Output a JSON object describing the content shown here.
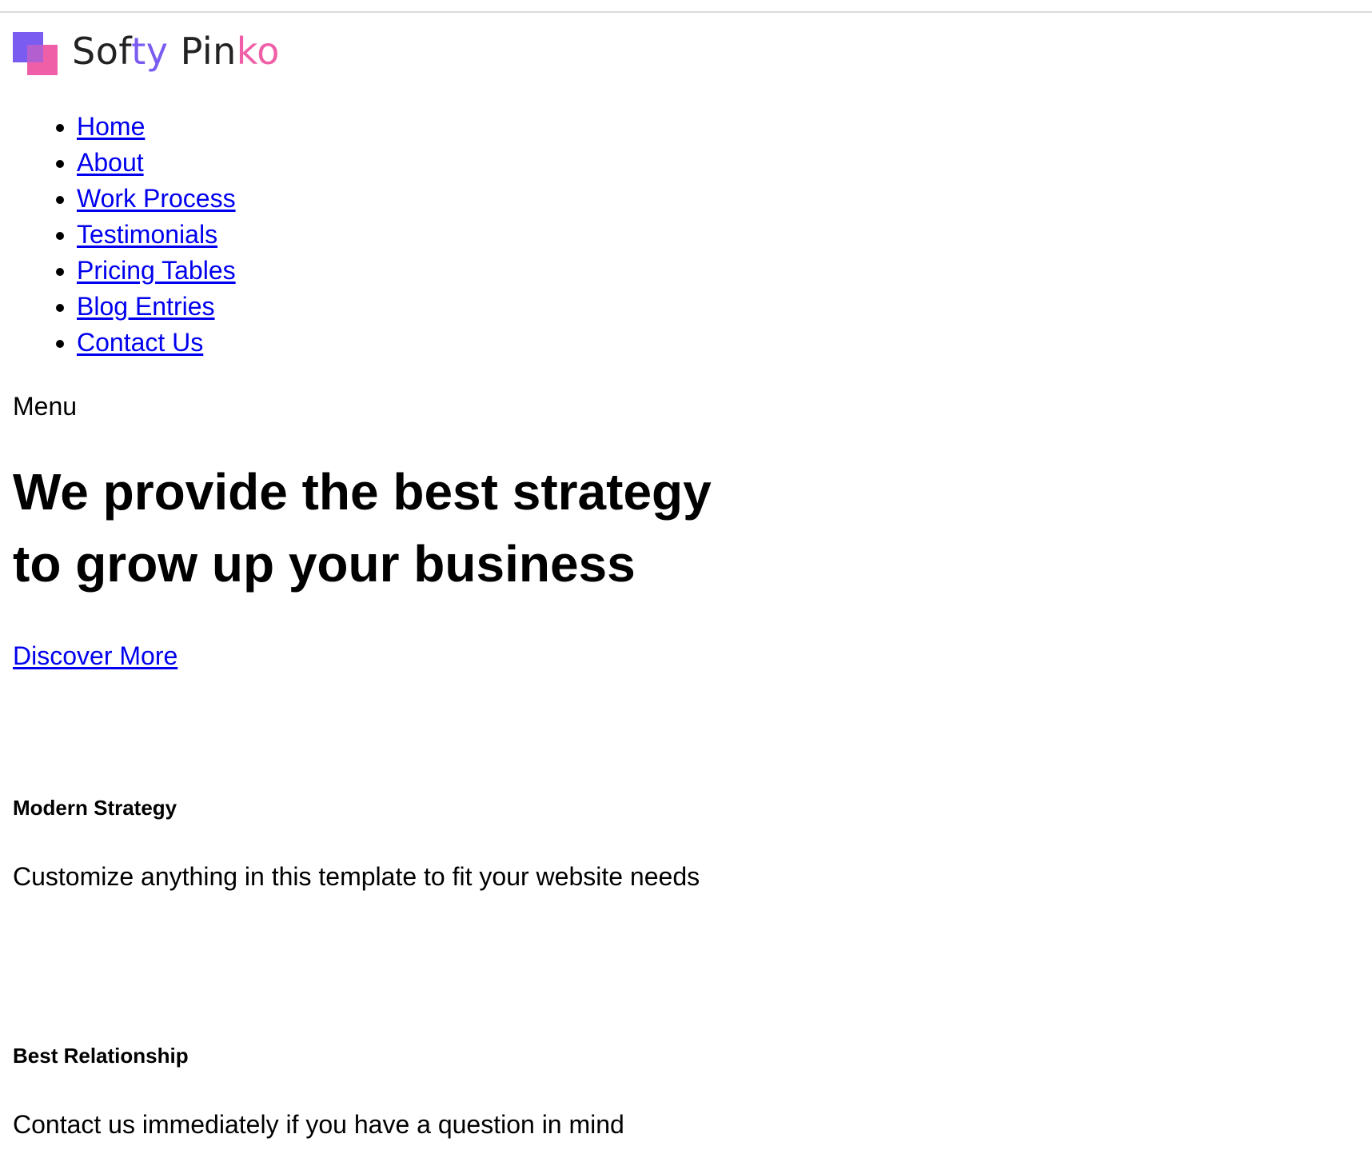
{
  "logo": {
    "parts": [
      {
        "text": "Sof",
        "tone": "dark"
      },
      {
        "text": "ty",
        "tone": "violet"
      },
      {
        "text": " Pin",
        "tone": "dark"
      },
      {
        "text": "ko",
        "tone": "pink"
      }
    ],
    "colors": {
      "violet": "#7b5cf0",
      "pink": "#ef5fa7",
      "dark": "#222222"
    }
  },
  "nav": {
    "items": [
      {
        "label": "Home"
      },
      {
        "label": "About"
      },
      {
        "label": "Work Process"
      },
      {
        "label": "Testimonials"
      },
      {
        "label": "Pricing Tables"
      },
      {
        "label": "Blog Entries"
      },
      {
        "label": "Contact Us"
      }
    ],
    "link_color": "#0000ee"
  },
  "menu_label": "Menu",
  "hero": {
    "line1": "We provide the best strategy",
    "line2": "to grow up your business",
    "cta": "Discover More"
  },
  "features": [
    {
      "title": "Modern Strategy",
      "text": "Customize anything in this template to fit your website needs"
    },
    {
      "title": "Best Relationship",
      "text": "Contact us immediately if you have a question in mind"
    }
  ]
}
